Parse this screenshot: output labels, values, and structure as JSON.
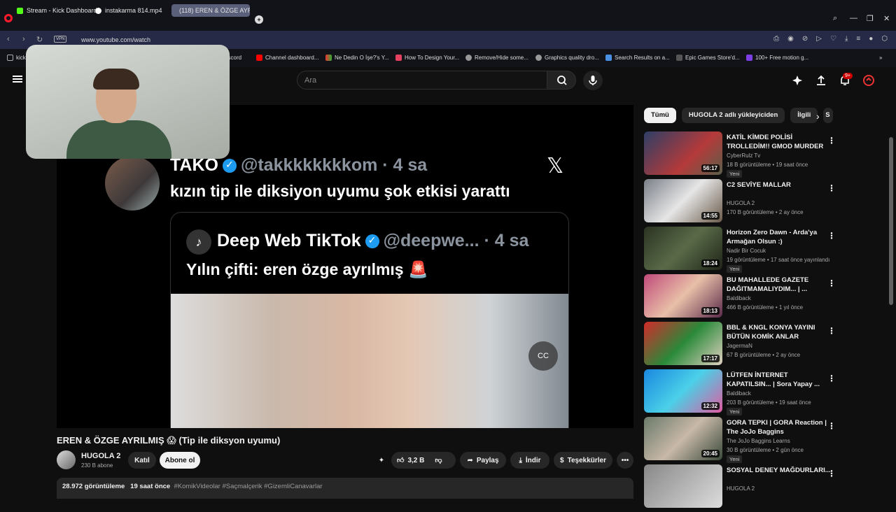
{
  "browser": {
    "tabs": [
      {
        "label": "Stream - Kick Dashboard",
        "active": false
      },
      {
        "label": "instakarma 814.mp4",
        "active": false
      },
      {
        "label": "(118) EREN & ÖZGE AYRIL",
        "active": true
      }
    ],
    "new_tab": "+",
    "url": "www.youtube.com/watch",
    "vpn": "VPN",
    "bookmarks": [
      {
        "label": "kick"
      },
      {
        "label": "Discord"
      },
      {
        "label": "Channel dashboard..."
      },
      {
        "label": "Ne Dedin O İşe?'s Y..."
      },
      {
        "label": "How To Design Your..."
      },
      {
        "label": "Remove/Hide some..."
      },
      {
        "label": "Graphics quality dro..."
      },
      {
        "label": "Search Results on a..."
      },
      {
        "label": "Epic Games Store'd..."
      },
      {
        "label": "100+ Free motion g..."
      }
    ],
    "colors": {
      "opera_red": "#ff1b2d",
      "address_bar": "#262a46"
    }
  },
  "youtube": {
    "search_placeholder": "Ara",
    "notification_count": "9+",
    "video": {
      "tweet": {
        "name": "TAKO",
        "handle": "@takkkkkkkkom · 4 sa",
        "text": "kızın tip ile diksiyon uyumu şok etkisi yarattı",
        "quote_name": "Deep Web TikTok",
        "quote_handle": "@deepwe... · 4 sa",
        "quote_text": "Yılın çifti: eren özge ayrılmış 🚨"
      },
      "cc_label": "CC"
    },
    "title": "EREN & ÖZGE AYRILMIŞ 😱 (Tip ile diksyon uyumu)",
    "channel": {
      "name": "HUGOLA 2",
      "subs": "230 B abone"
    },
    "actions": {
      "join": "Katıl",
      "subscribe": "Abone ol",
      "likes": "3,2 B",
      "share": "Paylaş",
      "download": "İndir",
      "thanks": "Teşekkürler",
      "more": "•••"
    },
    "description": {
      "views": "28.972 görüntüleme",
      "time": "19 saat önce",
      "tags": "#KomikVideolar #Saçmalçerik #GizemliCanavarlar"
    },
    "chips": [
      "Tümü",
      "HUGOLA 2 adlı yükleyiciden",
      "İlgili",
      "S"
    ],
    "recommendations": [
      {
        "title": "KATİL KİMDE POLİSİ TROLLEDİM!! GMOD MURDER",
        "channel": "CyberRulz Tv",
        "meta": "18 B görüntüleme • 19 saat önce",
        "badge": "Yeni",
        "duration": "56:17",
        "thumb": "linear-gradient(135deg,#2d3f66,#b53a3a 60%,#5a5f4a)"
      },
      {
        "title": "C2 SEVİYE MALLAR",
        "channel": "HUGOLA 2",
        "meta": "170 B görüntüleme • 2 ay önce",
        "badge": "",
        "duration": "14:55",
        "thumb": "linear-gradient(135deg,#7a7f88,#e6e6e6 50%,#6a5a4a)"
      },
      {
        "title": "Horizon Zero Dawn - Arda'ya Armağan Olsun :)",
        "channel": "Nadir Bir Cocuk",
        "meta": "19 görüntüleme • 17 saat önce yayınlandı",
        "badge": "Yeni",
        "duration": "18:24",
        "thumb": "linear-gradient(135deg,#2a3322,#5a6a48 50%,#1e2418)"
      },
      {
        "title": "BU MAHALLEDE GAZETE DAĞITMAMALIYDIM... | ...",
        "channel": "Baldiback",
        "meta": "466 B görüntüleme • 1 yıl önce",
        "badge": "",
        "duration": "18:13",
        "thumb": "linear-gradient(135deg,#c14a7a,#e8c0a8 50%,#5a2a4a)"
      },
      {
        "title": "BBL & KNGL KONYA YAYINI BÜTÜN KOMİK ANLAR",
        "channel": "JagermaN",
        "meta": "67 B görüntüleme • 2 ay önce",
        "badge": "",
        "duration": "17:17",
        "thumb": "linear-gradient(135deg,#d12a2a,#2a8a3a 50%,#e0d0c0)"
      },
      {
        "title": "LÜTFEN İNTERNET KAPATILSIN... | Sora Yapay ...",
        "channel": "Baldiback",
        "meta": "203 B görüntüleme • 19 saat önce",
        "badge": "Yeni",
        "duration": "12:32",
        "thumb": "linear-gradient(135deg,#1a88e0,#4ad0e8 50%,#e05aa0)"
      },
      {
        "title": "GORA TEPKI | GORA Reaction | The JoJo Baggins",
        "channel": "The JoJo Baggins Learns",
        "meta": "30 B görüntüleme • 2 gün önce",
        "badge": "Yeni",
        "duration": "20:45",
        "thumb": "linear-gradient(135deg,#6a7a6a,#c8b8a8 50%,#3a4a3a)"
      },
      {
        "title": "SOSYAL DENEY MAĞDURLARI...",
        "channel": "HUGOLA 2",
        "meta": "",
        "badge": "",
        "duration": "",
        "thumb": "linear-gradient(135deg,#888,#ddd)"
      }
    ]
  }
}
